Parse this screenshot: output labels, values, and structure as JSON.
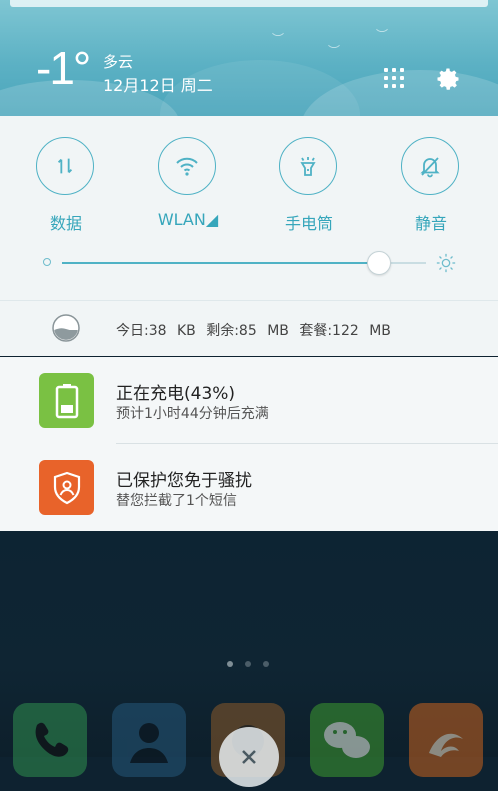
{
  "weather": {
    "temperature": "-1°",
    "condition": "多云",
    "date": "12月12日 周二"
  },
  "quick_toggles": [
    {
      "label": "数据",
      "icon": "data-transfer-icon"
    },
    {
      "label": "WLAN◢",
      "icon": "wifi-icon"
    },
    {
      "label": "手电筒",
      "icon": "flashlight-icon"
    },
    {
      "label": "静音",
      "icon": "bell-off-icon"
    }
  ],
  "brightness": {
    "level": 0.87
  },
  "data_usage": {
    "text": "今日:38 KB 剩余:85 MB 套餐:122 MB"
  },
  "notifications": [
    {
      "title": "正在充电(43%)",
      "subtitle": "预计1小时44分钟后充满",
      "icon": "battery-icon",
      "color": "#7ac143"
    },
    {
      "title": "已保护您免于骚扰",
      "subtitle": "替您拦截了1个短信",
      "icon": "shield-user-icon",
      "color": "#e8632a"
    }
  ],
  "colors": {
    "accent": "#4fb2c5",
    "header": "#5cb1c4"
  }
}
